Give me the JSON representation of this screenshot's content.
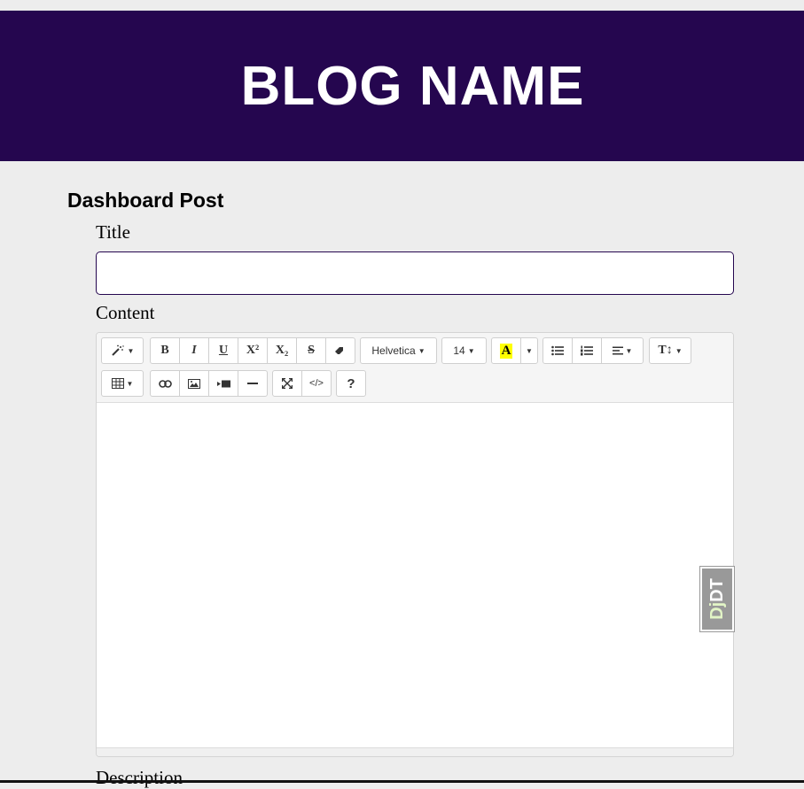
{
  "header": {
    "blog_name": "BLOG NAME"
  },
  "page": {
    "heading": "Dashboard Post"
  },
  "form": {
    "title_label": "Title",
    "title_value": "",
    "content_label": "Content",
    "description_label": "Description"
  },
  "toolbar": {
    "style_icon": "magic-wand-icon",
    "bold": "B",
    "italic": "I",
    "underline": "U",
    "superscript": "X²",
    "subscript": "X₂",
    "strikethrough": "S",
    "eraser_icon": "eraser-icon",
    "font_family": "Helvetica",
    "font_size": "14",
    "color_letter": "A",
    "height": "T↕",
    "table_icon": "table-icon",
    "link_icon": "link-icon",
    "picture_icon": "picture-icon",
    "video_icon": "video-icon",
    "hr_icon": "horizontal-rule-icon",
    "fullscreen_icon": "fullscreen-icon",
    "codeview": "</>",
    "help": "?"
  },
  "debug_toolbar": {
    "dj": "Dj",
    "dt": "DT"
  },
  "colors": {
    "header_bg": "#25064f",
    "page_bg": "#ededed",
    "highlight": "#ffff00"
  }
}
